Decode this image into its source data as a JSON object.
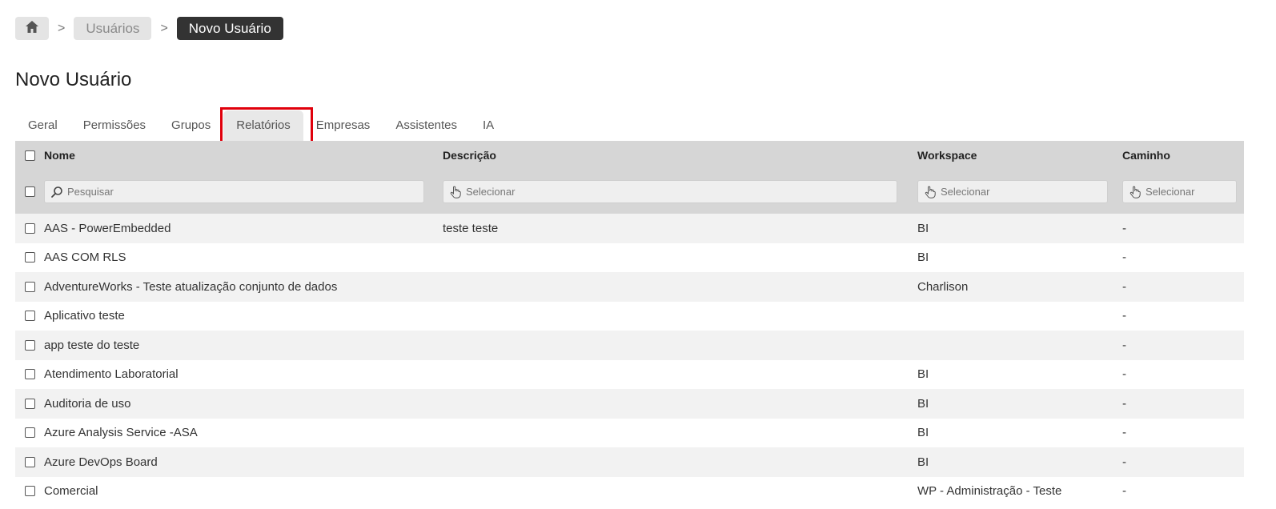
{
  "breadcrumb": {
    "home_icon": "home-icon",
    "items": [
      "Usuários",
      "Novo Usuário"
    ],
    "separator": ">"
  },
  "page": {
    "title": "Novo Usuário"
  },
  "tabs": [
    {
      "label": "Geral",
      "active": false
    },
    {
      "label": "Permissões",
      "active": false
    },
    {
      "label": "Grupos",
      "active": false
    },
    {
      "label": "Relatórios",
      "active": true
    },
    {
      "label": "Empresas",
      "active": false
    },
    {
      "label": "Assistentes",
      "active": false
    },
    {
      "label": "IA",
      "active": false
    }
  ],
  "table": {
    "columns": [
      "Nome",
      "Descrição",
      "Workspace",
      "Caminho"
    ],
    "filters": {
      "nome_placeholder": "Pesquisar",
      "descricao_placeholder": "Selecionar",
      "workspace_placeholder": "Selecionar",
      "caminho_placeholder": "Selecionar"
    },
    "rows": [
      {
        "nome": "AAS - PowerEmbedded",
        "descricao": "teste teste",
        "workspace": "BI",
        "caminho": "-"
      },
      {
        "nome": "AAS COM RLS",
        "descricao": "",
        "workspace": "BI",
        "caminho": "-"
      },
      {
        "nome": "AdventureWorks - Teste atualização conjunto de dados",
        "descricao": "",
        "workspace": "Charlison",
        "caminho": "-"
      },
      {
        "nome": "Aplicativo teste",
        "descricao": "",
        "workspace": "",
        "caminho": "-"
      },
      {
        "nome": "app teste do teste",
        "descricao": "",
        "workspace": "",
        "caminho": "-"
      },
      {
        "nome": "Atendimento Laboratorial",
        "descricao": "",
        "workspace": "BI",
        "caminho": "-"
      },
      {
        "nome": "Auditoria de uso",
        "descricao": "",
        "workspace": "BI",
        "caminho": "-"
      },
      {
        "nome": "Azure Analysis Service -ASA",
        "descricao": "",
        "workspace": "BI",
        "caminho": "-"
      },
      {
        "nome": "Azure DevOps Board",
        "descricao": "",
        "workspace": "BI",
        "caminho": "-"
      },
      {
        "nome": "Comercial",
        "descricao": "",
        "workspace": "WP - Administração - Teste",
        "caminho": "-"
      }
    ]
  },
  "colors": {
    "header_bg": "#d6d6d6",
    "active_crumb_bg": "#333333",
    "highlight": "#e0000c"
  }
}
